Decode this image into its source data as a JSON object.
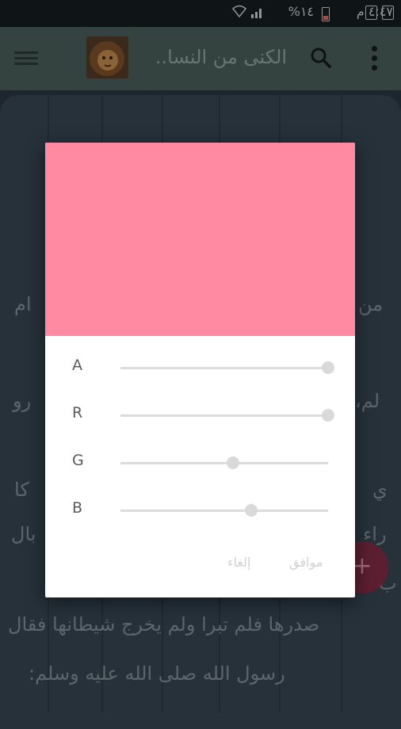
{
  "status_bar": {
    "time": "٤:٤٧ م",
    "battery": "%١٤"
  },
  "toolbar": {
    "title": "الكنى من النسا..",
    "menu_icon": "hamburger-menu-icon",
    "search_icon": "search-icon",
    "more_icon": "more-vertical-icon"
  },
  "background_text": {
    "line1": "ام",
    "line1_right": "من",
    "line2": "رو",
    "line2_right": "لم،",
    "line3": "كا",
    "line3_right": "ي",
    "line4": "بال",
    "line4_right": "راء",
    "line4b_right": "ب",
    "line5": "صدرها فلم تبرا ولم يخرج شيطانها فقال",
    "line6": "رسول الله صلى الله عليه وسلم:"
  },
  "fab": {
    "label": "+"
  },
  "dialog": {
    "preview_color": "#ff8aa1",
    "sliders": [
      {
        "label": "A",
        "value": 255
      },
      {
        "label": "R",
        "value": 255
      },
      {
        "label": "G",
        "value": 138
      },
      {
        "label": "B",
        "value": 161
      }
    ],
    "ok_label": "موافق",
    "cancel_label": "إلغاء"
  }
}
